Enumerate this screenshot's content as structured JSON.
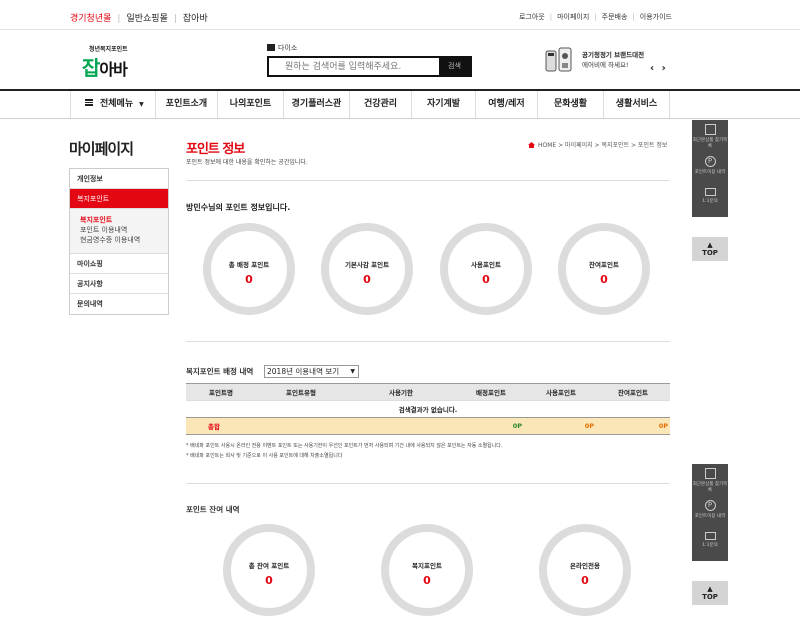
{
  "topbar": {
    "left_links": [
      "경기청년몰",
      "일반쇼핑몰",
      "잡아바"
    ],
    "right_links": [
      "로그아웃",
      "마이페이지",
      "주문배송",
      "이용가이드"
    ]
  },
  "header": {
    "logo_sub": "청년복지포인트",
    "logo_main_a": "잡",
    "logo_main_b": "아바",
    "search_tab": "다이소",
    "search_placeholder": "원하는 검색어를 입력해주세요.",
    "search_button": "검색",
    "promo_title": "공기청정기 브랜드대전",
    "promo_sub": "에어비에 하세요!",
    "promo_nav": "‹ ›"
  },
  "gnb": {
    "all_menu": "전체메뉴",
    "items": [
      "포인트소개",
      "나의포인트",
      "경기플러스관",
      "건강관리",
      "자기계발",
      "여행/레저",
      "문화생활",
      "생활서비스"
    ]
  },
  "sidebar": {
    "title": "마이페이지",
    "items": [
      "개인정보",
      "복지포인트",
      "마이쇼핑",
      "공지사항",
      "문의내역"
    ],
    "sub_items": [
      "복지포인트",
      "포인트 이용내역",
      "현금영수증 이용내역"
    ]
  },
  "main": {
    "title": "포인트 정보",
    "desc": "포인트 정보에 대한 내용을 확인하는 공간입니다.",
    "breadcrumb": "HOME > 마이페이지 > 복지포인트 > 포인트 정보",
    "greeting": "방민수님의 포인트 정보입니다.",
    "summary": [
      {
        "label": "총 배정 포인트",
        "value": "0"
      },
      {
        "label": "기본사감 포인트",
        "value": "0"
      },
      {
        "label": "사용포인트",
        "value": "0"
      },
      {
        "label": "잔여포인트",
        "value": "0"
      }
    ],
    "alloc_title": "복지포인트 배정 내역",
    "year_select": "2018년 이용내역 보기",
    "table_headers": [
      "포인트명",
      "포인트유형",
      "사용기한",
      "배정포인트",
      "사용포인트",
      "잔여포인트"
    ],
    "table_empty": "검색결과가 없습니다.",
    "sum_label": "총합",
    "sum_values": [
      "0P",
      "0P",
      "0P"
    ],
    "notes": [
      "* 배네파 포인트 사용시 온라인 전용 이벤트 포인트 또는 사용기한이 우선인 포인트가 먼저 사용되며 기간 내에 사용되지 않은 포인트는 자동 소멸됩니다.",
      "* 배네파 포인트는 회사 및 기준으로 이 사용 포인트에 대해 차출소멸됩니다"
    ],
    "balance_title": "포인트 잔여 내역",
    "balance": [
      {
        "label": "총 잔여 포인트",
        "value": "0"
      },
      {
        "label": "복지포인트",
        "value": "0"
      },
      {
        "label": "온라인전용",
        "value": "0"
      }
    ]
  },
  "quickbar": {
    "items": [
      "최근본상품 찾기목록",
      "포인트이용 내역",
      "1:1문의"
    ],
    "icons": [
      "building-icon",
      "point-icon",
      "card-icon"
    ],
    "top": "TOP",
    "top_arrow": "▲"
  }
}
